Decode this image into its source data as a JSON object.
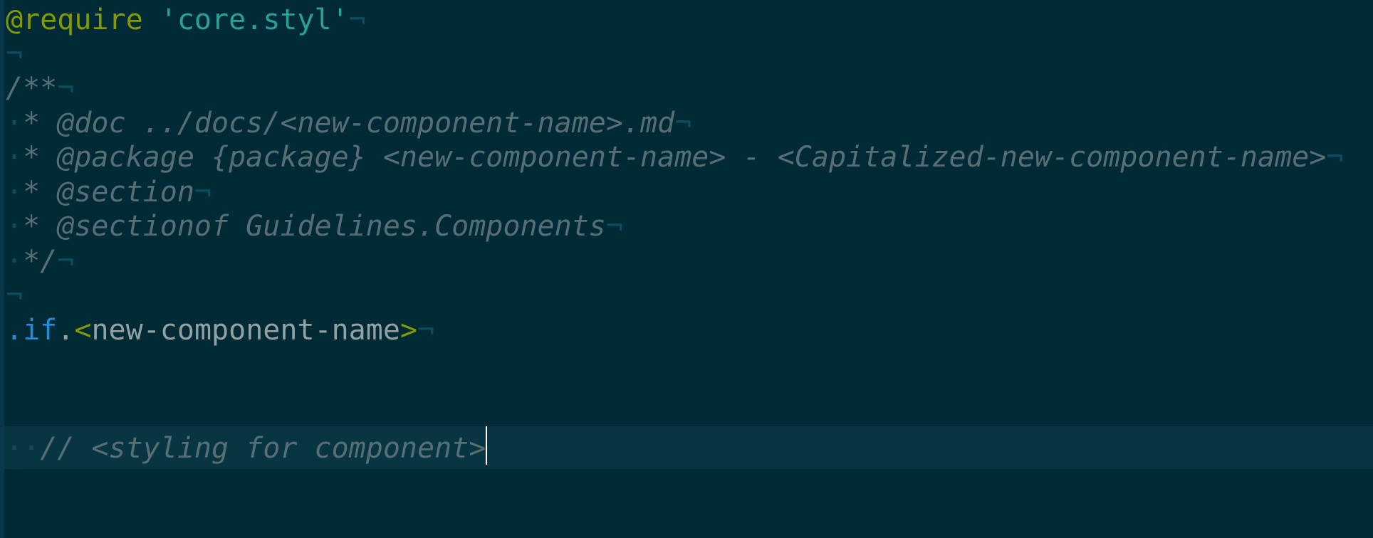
{
  "editor": {
    "language": "stylus",
    "eol_marker": "¬",
    "whitespace_marker": "·",
    "colors": {
      "background": "#002b36",
      "current_line": "#073642",
      "keyword": "#859900",
      "string": "#2aa198",
      "comment": "#586e75",
      "class_keyword": "#268bd2",
      "text": "#93a1a1"
    },
    "lines": {
      "l1": {
        "keyword": "@require",
        "space": " ",
        "string": "'core.styl'"
      },
      "l3": {
        "comment": "/**"
      },
      "l4": {
        "comment": "* @doc ../docs/<new-component-name>.md"
      },
      "l5": {
        "comment": "* @package {package} <new-component-name> - <Capitalized-new-component-name>"
      },
      "l6": {
        "comment": "* @section"
      },
      "l7": {
        "comment": "* @sectionof Guidelines.Components"
      },
      "l8": {
        "comment": "*/"
      },
      "l10": {
        "dot1": ".",
        "cls": "if",
        "dot2": ".",
        "lt": "<",
        "name": "new-component-name",
        "gt": ">"
      },
      "l11": {
        "comment": "// <styling for component>"
      }
    }
  }
}
